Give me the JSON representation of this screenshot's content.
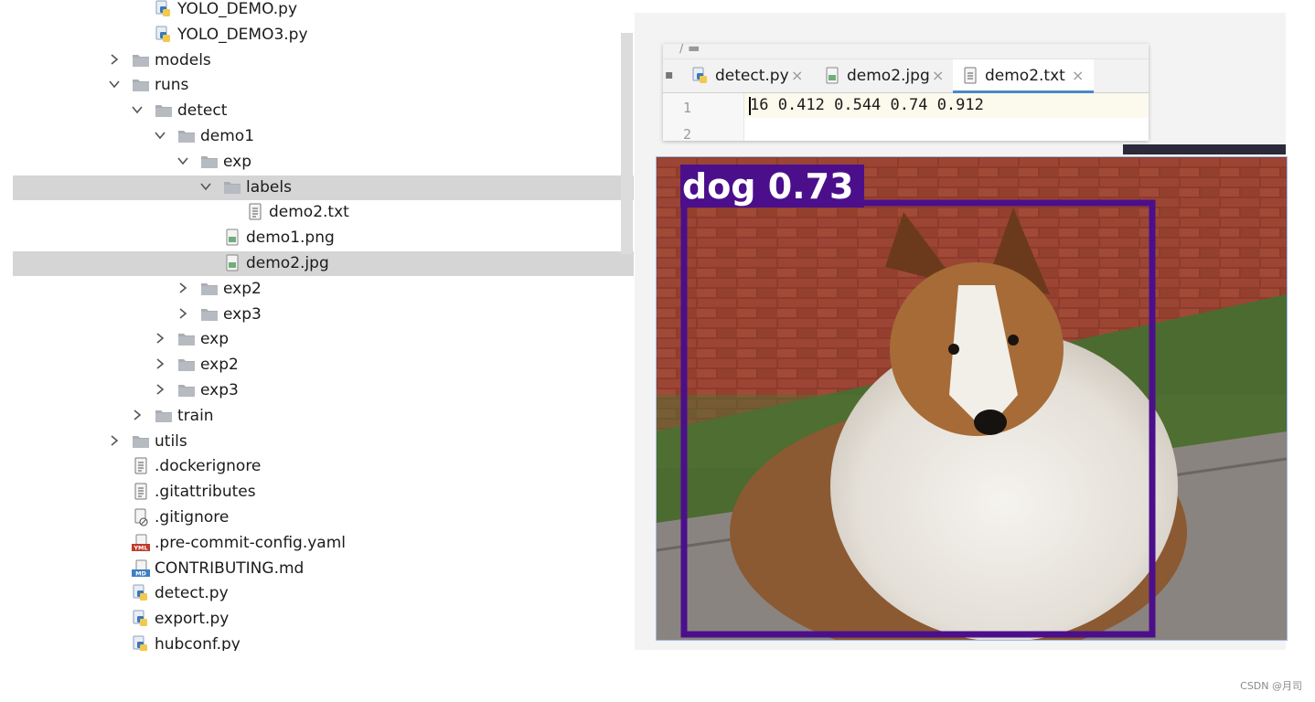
{
  "project_tree": {
    "items": [
      {
        "label": "YOLO_DEMO.py",
        "type": "python",
        "depth": 2,
        "arrow": "none",
        "selected": false
      },
      {
        "label": "YOLO_DEMO3.py",
        "type": "python",
        "depth": 2,
        "arrow": "none",
        "selected": false
      },
      {
        "label": "models",
        "type": "folder",
        "depth": 1,
        "arrow": "collapsed",
        "selected": false
      },
      {
        "label": "runs",
        "type": "folder",
        "depth": 1,
        "arrow": "expanded",
        "selected": false
      },
      {
        "label": "detect",
        "type": "folder",
        "depth": 2,
        "arrow": "expanded",
        "selected": false
      },
      {
        "label": "demo1",
        "type": "folder",
        "depth": 3,
        "arrow": "expanded",
        "selected": false
      },
      {
        "label": "exp",
        "type": "folder",
        "depth": 4,
        "arrow": "expanded",
        "selected": false
      },
      {
        "label": "labels",
        "type": "folder",
        "depth": 5,
        "arrow": "expanded",
        "selected": true
      },
      {
        "label": "demo2.txt",
        "type": "text",
        "depth": 6,
        "arrow": "none",
        "selected": false
      },
      {
        "label": "demo1.png",
        "type": "image",
        "depth": 5,
        "arrow": "none",
        "selected": false
      },
      {
        "label": "demo2.jpg",
        "type": "image",
        "depth": 5,
        "arrow": "none",
        "selected": true
      },
      {
        "label": "exp2",
        "type": "folder",
        "depth": 4,
        "arrow": "collapsed",
        "selected": false
      },
      {
        "label": "exp3",
        "type": "folder",
        "depth": 4,
        "arrow": "collapsed",
        "selected": false
      },
      {
        "label": "exp",
        "type": "folder",
        "depth": 3,
        "arrow": "collapsed",
        "selected": false
      },
      {
        "label": "exp2",
        "type": "folder",
        "depth": 3,
        "arrow": "collapsed",
        "selected": false
      },
      {
        "label": "exp3",
        "type": "folder",
        "depth": 3,
        "arrow": "collapsed",
        "selected": false
      },
      {
        "label": "train",
        "type": "folder",
        "depth": 2,
        "arrow": "collapsed",
        "selected": false
      },
      {
        "label": "utils",
        "type": "folder",
        "depth": 1,
        "arrow": "collapsed",
        "selected": false
      },
      {
        "label": ".dockerignore",
        "type": "text",
        "depth": 1,
        "arrow": "none",
        "selected": false
      },
      {
        "label": ".gitattributes",
        "type": "text",
        "depth": 1,
        "arrow": "none",
        "selected": false
      },
      {
        "label": ".gitignore",
        "type": "ignore",
        "depth": 1,
        "arrow": "none",
        "selected": false
      },
      {
        "label": ".pre-commit-config.yaml",
        "type": "yaml",
        "depth": 1,
        "arrow": "none",
        "selected": false
      },
      {
        "label": "CONTRIBUTING.md",
        "type": "markdown",
        "depth": 1,
        "arrow": "none",
        "selected": false
      },
      {
        "label": "detect.py",
        "type": "python",
        "depth": 1,
        "arrow": "none",
        "selected": false
      },
      {
        "label": "export.py",
        "type": "python",
        "depth": 1,
        "arrow": "none",
        "selected": false
      },
      {
        "label": "hubconf.py",
        "type": "python",
        "depth": 1,
        "arrow": "none",
        "selected": false
      }
    ]
  },
  "editor": {
    "tabs": [
      {
        "label": "detect.py",
        "icon": "python-file-icon",
        "close": "×",
        "active": false
      },
      {
        "label": "demo2.jpg",
        "icon": "image-file-icon",
        "close": "×",
        "active": false
      },
      {
        "label": "demo2.txt",
        "icon": "text-file-icon",
        "close": "×",
        "active": true
      }
    ],
    "line_numbers": [
      "1",
      "2"
    ],
    "code_line": "16 0.412 0.544 0.74 0.912"
  },
  "detection": {
    "label": "dog 0.73",
    "box_color": "#4b0f8c"
  },
  "watermark": "CSDN @月司",
  "colors": {
    "selection": "#d5d5d5",
    "tab_underline": "#4a88c7",
    "folder": "#a9aeb4"
  }
}
